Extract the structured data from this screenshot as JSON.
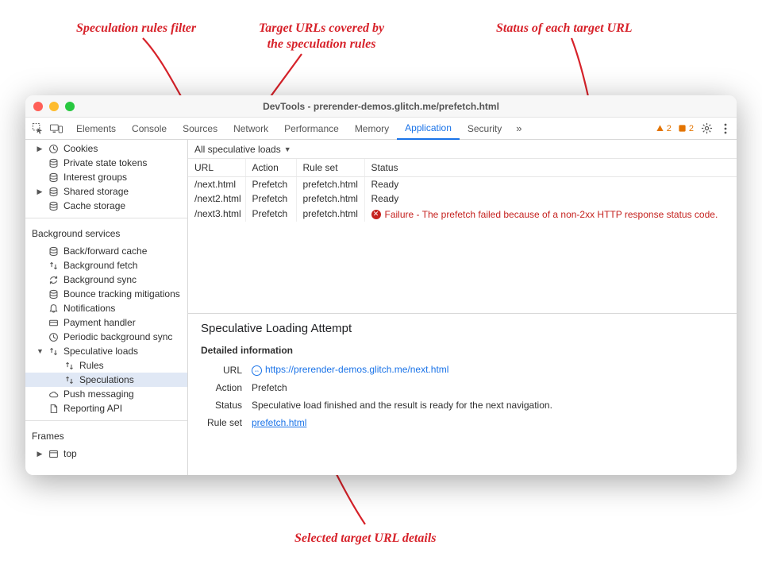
{
  "annotations": {
    "filter": "Speculation rules filter",
    "targets": "Target URLs covered by\nthe speculation rules",
    "status": "Status of each target URL",
    "details": "Selected target URL details"
  },
  "window": {
    "title": "DevTools - prerender-demos.glitch.me/prefetch.html"
  },
  "tabs": {
    "items": [
      "Elements",
      "Console",
      "Sources",
      "Network",
      "Performance",
      "Memory",
      "Application",
      "Security"
    ],
    "active": "Application",
    "warnings": "2",
    "issues": "2"
  },
  "sidebar": {
    "storage": [
      {
        "label": "Cookies",
        "icon": "clock",
        "caret": true
      },
      {
        "label": "Private state tokens",
        "icon": "db"
      },
      {
        "label": "Interest groups",
        "icon": "db"
      },
      {
        "label": "Shared storage",
        "icon": "db",
        "caret": true
      },
      {
        "label": "Cache storage",
        "icon": "db"
      }
    ],
    "bg_title": "Background services",
    "bg": [
      {
        "label": "Back/forward cache",
        "icon": "db"
      },
      {
        "label": "Background fetch",
        "icon": "updown"
      },
      {
        "label": "Background sync",
        "icon": "sync"
      },
      {
        "label": "Bounce tracking mitigations",
        "icon": "db"
      },
      {
        "label": "Notifications",
        "icon": "bell"
      },
      {
        "label": "Payment handler",
        "icon": "card"
      },
      {
        "label": "Periodic background sync",
        "icon": "clock"
      },
      {
        "label": "Speculative loads",
        "icon": "updown",
        "caret": true,
        "expanded": true
      },
      {
        "label": "Rules",
        "icon": "updown",
        "child": true
      },
      {
        "label": "Speculations",
        "icon": "updown",
        "child": true,
        "selected": true
      },
      {
        "label": "Push messaging",
        "icon": "cloud"
      },
      {
        "label": "Reporting API",
        "icon": "doc"
      }
    ],
    "frames_title": "Frames",
    "frames": [
      {
        "label": "top",
        "icon": "frame",
        "caret": true
      }
    ]
  },
  "filter": {
    "label": "All speculative loads"
  },
  "table": {
    "headers": [
      "URL",
      "Action",
      "Rule set",
      "Status"
    ],
    "rows": [
      {
        "url": "/next.html",
        "action": "Prefetch",
        "ruleset": "prefetch.html",
        "status": "Ready",
        "ok": true
      },
      {
        "url": "/next2.html",
        "action": "Prefetch",
        "ruleset": "prefetch.html",
        "status": "Ready",
        "ok": true
      },
      {
        "url": "/next3.html",
        "action": "Prefetch",
        "ruleset": "prefetch.html",
        "status": "Failure - The prefetch failed because of a non-2xx HTTP response status code.",
        "ok": false
      }
    ]
  },
  "details": {
    "title": "Speculative Loading Attempt",
    "subtitle": "Detailed information",
    "url_label": "URL",
    "url": "https://prerender-demos.glitch.me/next.html",
    "action_label": "Action",
    "action": "Prefetch",
    "status_label": "Status",
    "status": "Speculative load finished and the result is ready for the next navigation.",
    "ruleset_label": "Rule set",
    "ruleset": "prefetch.html"
  }
}
